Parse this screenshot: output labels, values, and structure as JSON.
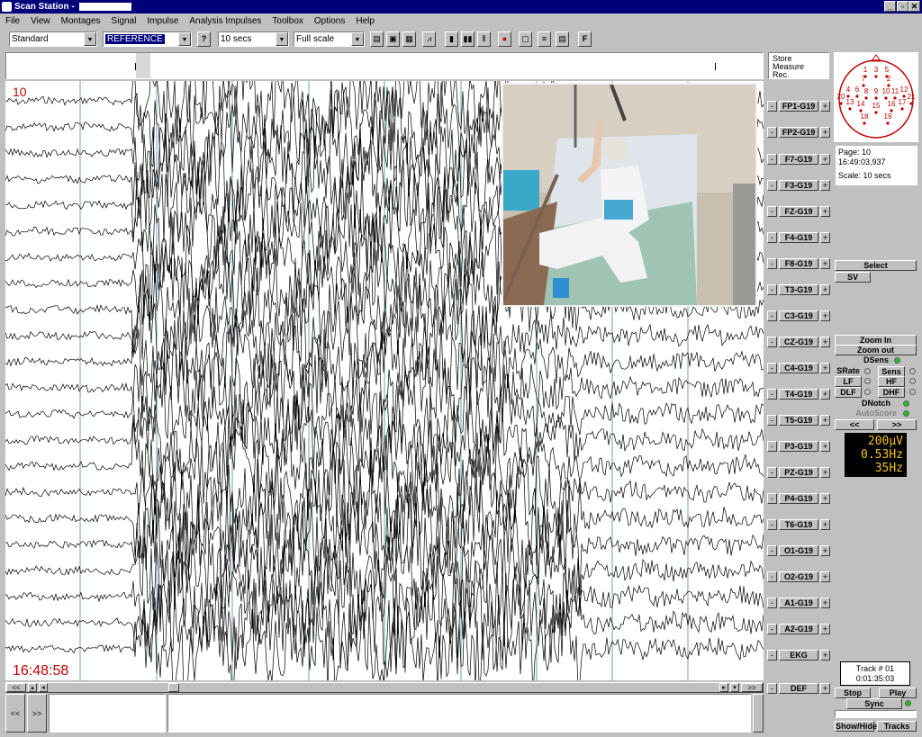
{
  "window": {
    "title": "Scan Station -"
  },
  "menu": [
    "File",
    "View",
    "Montages",
    "Signal",
    "Impulse",
    "Analysis Impulses",
    "Toolbox",
    "Options",
    "Help"
  ],
  "toolbar": {
    "montage": "Standard",
    "reference": "REFERENCE",
    "timebase": "10 secs",
    "scale": "Full scale",
    "help_label": "?"
  },
  "eeg": {
    "page_marker": "10",
    "start_time": "16:48:58",
    "channels": [
      "FP1-G19",
      "FP2-G19",
      "F7-G19",
      "F3-G19",
      "FZ-G19",
      "F4-G19",
      "F8-G19",
      "T3-G19",
      "C3-G19",
      "CZ-G19",
      "C4-G19",
      "T4-G19",
      "T5-G19",
      "P3-G19",
      "PZ-G19",
      "P4-G19",
      "T6-G19",
      "O1-G19",
      "O2-G19",
      "A1-G19",
      "A2-G19",
      "EKG",
      "DEF"
    ]
  },
  "right_panel": {
    "store_lines": [
      "Store",
      "Measure",
      "Rec."
    ],
    "page_info": {
      "page": "Page: 10",
      "time": "16:49:03,937",
      "scale": "Scale: 10 secs"
    },
    "head_numbers": [
      "1",
      "3",
      "5",
      "7",
      "2",
      "4",
      "6",
      "8",
      "9",
      "10",
      "11",
      "12",
      "20",
      "13",
      "14",
      "15",
      "16",
      "17",
      "21",
      "18",
      "19"
    ],
    "select_label": "Select",
    "sv_label": "SV",
    "zoom_in": "Zoom In",
    "zoom_out": "Zoom out",
    "dsens": "DSens",
    "srate": "SRate",
    "sens": "Sens",
    "lf": "LF",
    "hf": "HF",
    "dlf": "DLF",
    "dhf": "DHF",
    "dnotch": "DNotch",
    "autoscore": "AutoScore",
    "prev": "<<",
    "next": ">>",
    "lcd": [
      "200µV",
      "0.53Hz",
      "35Hz"
    ],
    "track": {
      "number": "Track # 01",
      "time": "0:01:35:03"
    },
    "stop": "Stop",
    "play": "Play",
    "sync": "Sync",
    "show_hide": "Show/Hide",
    "tracks": "Tracks"
  },
  "bottom": {
    "first": "<<",
    "last": ">>",
    "left": "<<",
    "right": ">>"
  },
  "colors": {
    "titlebar": "#00007b",
    "marker_red": "#c00000",
    "lcd_text": "#f0c020",
    "grid": "#4a8fa0"
  }
}
